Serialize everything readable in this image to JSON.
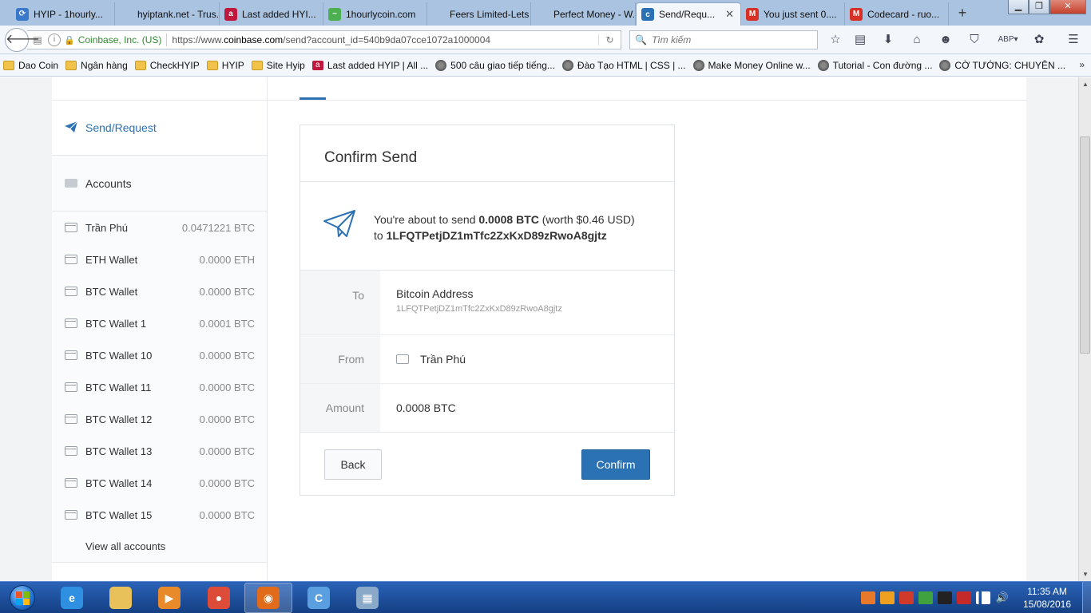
{
  "browser": {
    "tabs": [
      {
        "label": "HYIP - 1hourly...",
        "favicon_color": "#3a78c9",
        "favicon_glyph": "⟳"
      },
      {
        "label": "hyiptank.net - Trus...",
        "favicon_color": "#a9c3e0",
        "favicon_glyph": ""
      },
      {
        "label": "Last added HYI...",
        "favicon_color": "#c0183c",
        "favicon_glyph": "a"
      },
      {
        "label": "1hourlycoin.com",
        "favicon_color": "#4caf50",
        "favicon_glyph": "~"
      },
      {
        "label": "Feers Limited-Lets ...",
        "favicon_color": "#a9c3e0",
        "favicon_glyph": ""
      },
      {
        "label": "Perfect Money - W...",
        "favicon_color": "#a9c3e0",
        "favicon_glyph": ""
      },
      {
        "label": "Send/Requ...",
        "favicon_color": "#2b72b4",
        "favicon_glyph": "c",
        "active": true
      },
      {
        "label": "You just sent 0....",
        "favicon_color": "#d93025",
        "favicon_glyph": "M"
      },
      {
        "label": "Codecard - ruo...",
        "favicon_color": "#d93025",
        "favicon_glyph": "M"
      }
    ],
    "tab_close_glyph": "✕",
    "new_tab_glyph": "+",
    "window_controls": {
      "minimize": "▁",
      "restore": "❐",
      "close": "✕"
    },
    "site_identity": "Coinbase, Inc. (US)",
    "url_prefix": "https://www.",
    "url_domain": "coinbase.com",
    "url_path": "/send?account_id=540b9da07cce1072a1000004",
    "search_placeholder": "Tìm kiếm",
    "toolbar_icons": [
      "star-icon",
      "reading-list-icon",
      "download-icon",
      "home-icon",
      "chat-icon",
      "pocket-icon",
      "adblock-icon",
      "extension-icon",
      "menu-icon"
    ],
    "bookmarks": [
      {
        "label": "Dao Coin",
        "icon": "folder"
      },
      {
        "label": "Ngân hàng",
        "icon": "folder"
      },
      {
        "label": "CheckHYIP",
        "icon": "folder"
      },
      {
        "label": "HYIP",
        "icon": "folder"
      },
      {
        "label": "Site Hyip",
        "icon": "folder"
      },
      {
        "label": "Last added HYIP | All ...",
        "icon": "red-a"
      },
      {
        "label": "500 câu giao tiếp tiếng...",
        "icon": "globe"
      },
      {
        "label": "Đào Tạo HTML | CSS | ...",
        "icon": "globe"
      },
      {
        "label": "Make Money Online w...",
        "icon": "globe"
      },
      {
        "label": "Tutorial - Con đường ...",
        "icon": "globe"
      },
      {
        "label": "CỜ TƯỚNG: CHUYÊN ...",
        "icon": "globe"
      }
    ],
    "bookmarks_overflow": "»"
  },
  "sidebar": {
    "send_request_label": "Send/Request",
    "accounts_label": "Accounts",
    "accounts": [
      {
        "name": "Trần Phú",
        "balance": "0.0471221 BTC"
      },
      {
        "name": "ETH Wallet",
        "balance": "0.0000 ETH"
      },
      {
        "name": "BTC Wallet",
        "balance": "0.0000 BTC"
      },
      {
        "name": "BTC Wallet 1",
        "balance": "0.0001 BTC"
      },
      {
        "name": "BTC Wallet 10",
        "balance": "0.0000 BTC"
      },
      {
        "name": "BTC Wallet 11",
        "balance": "0.0000 BTC"
      },
      {
        "name": "BTC Wallet 12",
        "balance": "0.0000 BTC"
      },
      {
        "name": "BTC Wallet 13",
        "balance": "0.0000 BTC"
      },
      {
        "name": "BTC Wallet 14",
        "balance": "0.0000 BTC"
      },
      {
        "name": "BTC Wallet 15",
        "balance": "0.0000 BTC"
      }
    ],
    "view_all_label": "View all accounts"
  },
  "confirm": {
    "title": "Confirm Send",
    "summary_prefix": "You're about to send ",
    "summary_amount": "0.0008 BTC",
    "summary_worth": " (worth $0.46 USD)",
    "summary_to": "to ",
    "summary_address": "1LFQTPetjDZ1mTfc2ZxKxD89zRwoA8gjtz",
    "to_label": "To",
    "to_type": "Bitcoin Address",
    "to_address": "1LFQTPetjDZ1mTfc2ZxKxD89zRwoA8gjtz",
    "from_label": "From",
    "from_value": "Trần Phú",
    "amount_label": "Amount",
    "amount_value": "0.0008 BTC",
    "back_label": "Back",
    "confirm_label": "Confirm"
  },
  "colors": {
    "accent": "#2b72b4",
    "taskbar": "#1f4f9c",
    "tab_bar": "#a9c3e0"
  },
  "taskbar": {
    "apps": [
      {
        "name": "ie-icon",
        "color": "#2f8fe0",
        "glyph": "e"
      },
      {
        "name": "explorer-icon",
        "color": "#e8c15a",
        "glyph": ""
      },
      {
        "name": "media-player-icon",
        "color": "#e98a2a",
        "glyph": "▶"
      },
      {
        "name": "chrome-icon",
        "color": "#dd4b39",
        "glyph": "●"
      },
      {
        "name": "firefox-icon",
        "color": "#e06b1b",
        "glyph": "◉",
        "active": true
      },
      {
        "name": "app-c-icon",
        "color": "#5aa0e0",
        "glyph": "C"
      },
      {
        "name": "calculator-icon",
        "color": "#8aa8c8",
        "glyph": "▦"
      }
    ],
    "clock_time": "11:35 AM",
    "clock_date": "15/08/2016"
  }
}
